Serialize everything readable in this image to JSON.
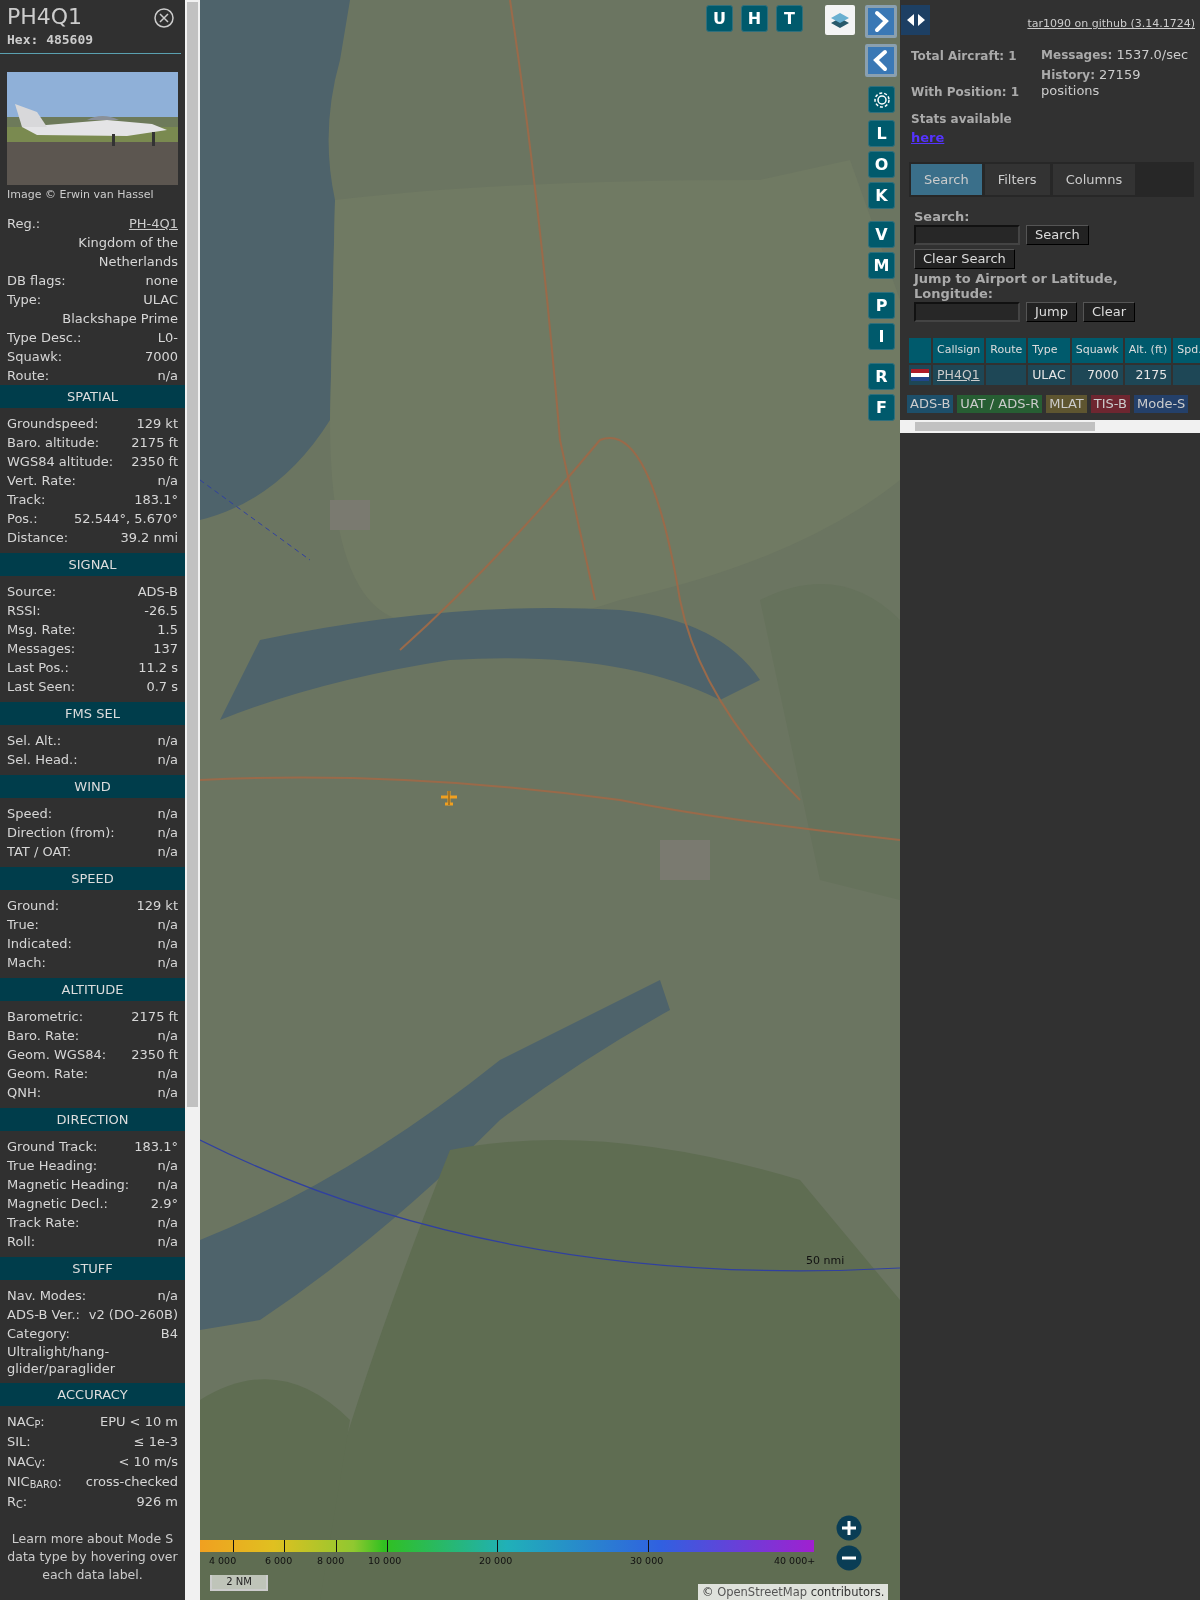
{
  "sidebar": {
    "title": "PH4Q1",
    "hex": "Hex: 485609",
    "image_credit": "Image © Erwin van Hassel",
    "info_rows": [
      {
        "kind": "link",
        "label": "Reg.:",
        "value": "PH-4Q1"
      },
      {
        "kind": "note",
        "value": "Kingdom of the Netherlands"
      },
      {
        "kind": "pair",
        "label": "DB flags:",
        "value": "none"
      },
      {
        "kind": "pair",
        "label": "Type:",
        "value": "ULAC"
      },
      {
        "kind": "note",
        "value": "Blackshape Prime"
      },
      {
        "kind": "pair",
        "label": "Type Desc.:",
        "value": "L0-"
      },
      {
        "kind": "pair",
        "label": "Squawk:",
        "value": "7000"
      },
      {
        "kind": "pair",
        "label": "Route:",
        "value": "n/a"
      }
    ],
    "sections": [
      {
        "heading": "SPATIAL",
        "rows": [
          {
            "kind": "pair",
            "label": "Groundspeed:",
            "value": "129 kt"
          },
          {
            "kind": "pair",
            "label": "Baro. altitude:",
            "value": "2175 ft"
          },
          {
            "kind": "pair",
            "label": "WGS84 altitude:",
            "value": "2350 ft"
          },
          {
            "kind": "pair",
            "label": "Vert. Rate:",
            "value": "n/a"
          },
          {
            "kind": "pair",
            "label": "Track:",
            "value": "183.1°"
          },
          {
            "kind": "pair",
            "label": "Pos.:",
            "value": "52.544°, 5.670°"
          },
          {
            "kind": "pair",
            "label": "Distance:",
            "value": "39.2 nmi"
          }
        ]
      },
      {
        "heading": "SIGNAL",
        "rows": [
          {
            "kind": "pair",
            "label": "Source:",
            "value": "ADS-B"
          },
          {
            "kind": "pair",
            "label": "RSSI:",
            "value": "-26.5"
          },
          {
            "kind": "pair",
            "label": "Msg. Rate:",
            "value": "1.5"
          },
          {
            "kind": "pair",
            "label": "Messages:",
            "value": "137"
          },
          {
            "kind": "pair",
            "label": "Last Pos.:",
            "value": "11.2 s"
          },
          {
            "kind": "pair",
            "label": "Last Seen:",
            "value": "0.7 s"
          }
        ]
      },
      {
        "heading": "FMS SEL",
        "rows": [
          {
            "kind": "pair",
            "label": "Sel. Alt.:",
            "value": "n/a"
          },
          {
            "kind": "pair",
            "label": "Sel. Head.:",
            "value": "n/a"
          }
        ]
      },
      {
        "heading": "WIND",
        "rows": [
          {
            "kind": "pair",
            "label": "Speed:",
            "value": "n/a"
          },
          {
            "kind": "pair",
            "label": "Direction (from):",
            "value": "n/a"
          },
          {
            "kind": "pair",
            "label": "TAT / OAT:",
            "value": "n/a"
          }
        ]
      },
      {
        "heading": "SPEED",
        "rows": [
          {
            "kind": "pair",
            "label": "Ground:",
            "value": "129 kt"
          },
          {
            "kind": "pair",
            "label": "True:",
            "value": "n/a"
          },
          {
            "kind": "pair",
            "label": "Indicated:",
            "value": "n/a"
          },
          {
            "kind": "pair",
            "label": "Mach:",
            "value": "n/a"
          }
        ]
      },
      {
        "heading": "ALTITUDE",
        "rows": [
          {
            "kind": "pair",
            "label": "Barometric:",
            "value": "2175 ft"
          },
          {
            "kind": "pair",
            "label": "Baro. Rate:",
            "value": "n/a"
          },
          {
            "kind": "pair",
            "label": "Geom. WGS84:",
            "value": "2350 ft"
          },
          {
            "kind": "pair",
            "label": "Geom. Rate:",
            "value": "n/a"
          },
          {
            "kind": "pair",
            "label": "QNH:",
            "value": "n/a"
          }
        ]
      },
      {
        "heading": "DIRECTION",
        "rows": [
          {
            "kind": "pair",
            "label": "Ground Track:",
            "value": "183.1°"
          },
          {
            "kind": "pair",
            "label": "True Heading:",
            "value": "n/a"
          },
          {
            "kind": "pair",
            "label": "Magnetic Heading:",
            "value": "n/a"
          },
          {
            "kind": "pair",
            "label": "Magnetic Decl.:",
            "value": "2.9°"
          },
          {
            "kind": "pair",
            "label": "Track Rate:",
            "value": "n/a"
          },
          {
            "kind": "pair",
            "label": "Roll:",
            "value": "n/a"
          }
        ]
      },
      {
        "heading": "STUFF",
        "rows": [
          {
            "kind": "pair",
            "label": "Nav. Modes:",
            "value": "n/a"
          },
          {
            "kind": "pair",
            "label": "ADS-B Ver.:",
            "value": "v2 (DO-260B)"
          },
          {
            "kind": "pair",
            "label": "Category:",
            "value": "B4"
          },
          {
            "kind": "wide",
            "value": "Ultralight/hang-glider/paraglider"
          }
        ]
      },
      {
        "heading": "ACCURACY",
        "rows": [
          {
            "kind": "pair",
            "label": "NAC$_{P}$:",
            "value": "EPU < 10 m"
          },
          {
            "kind": "pair",
            "label": "SIL:",
            "value": "≤ 1e-3"
          },
          {
            "kind": "pair",
            "label": "NAC$_{V}$:",
            "value": "< 10 m/s"
          },
          {
            "kind": "pair",
            "label": "NIC$_{BARO}$:",
            "value": "cross-checked"
          },
          {
            "kind": "pair",
            "label": "R$_{C}$:",
            "value": "926 m"
          }
        ]
      }
    ],
    "footer": "Learn more about Mode S data type by hovering over each data label."
  },
  "map": {
    "top_buttons": [
      "U",
      "H",
      "T"
    ],
    "side_buttons": [
      "L",
      "O",
      "K",
      "V",
      "M",
      "P",
      "I",
      "R",
      "F"
    ],
    "range_label": "50 nmi",
    "legend": [
      "4 000",
      "6 000",
      "8 000",
      "10 000",
      "20 000",
      "30 000",
      "40 000+"
    ],
    "scale": "2 NM",
    "attribution": {
      "prefix": "©",
      "link": "OpenStreetMap",
      "suffix": "contributors."
    }
  },
  "panel": {
    "version_link": "tar1090 on github (3.14.1724)",
    "stats_left": [
      {
        "label": "Total Aircraft:",
        "value": "1"
      },
      {
        "label": "With Position:",
        "value": "1"
      }
    ],
    "stats_right": [
      {
        "label": "Messages:",
        "value": "1537.0/sec"
      },
      {
        "label": "History:",
        "value": "27159 positions"
      }
    ],
    "stats_note": "Stats available",
    "stats_link": "here",
    "tabs": [
      {
        "label": "Search",
        "selected": true
      },
      {
        "label": "Filters",
        "selected": false
      },
      {
        "label": "Columns",
        "selected": false
      }
    ],
    "search": {
      "label": "Search:",
      "button": "Search",
      "clear_button": "Clear Search"
    },
    "jump": {
      "label": "Jump to Airport or Latitude, Longitude:",
      "button": "Jump",
      "clear_button": "Clear"
    },
    "table": {
      "columns": [
        "Callsign",
        "Route",
        "Type",
        "Squawk",
        "Alt. (ft)",
        "Spd."
      ],
      "rows": [
        {
          "callsign": "PH4Q1",
          "type": "ULAC",
          "squawk": "7000",
          "altitude": "2175"
        }
      ]
    },
    "sources": [
      {
        "label": "ADS-B",
        "color": "#1d4f6a"
      },
      {
        "label": "UAT / ADS-R",
        "color": "#275e33"
      },
      {
        "label": "MLAT",
        "color": "#5e5530"
      },
      {
        "label": "TIS-B",
        "color": "#6e2630"
      },
      {
        "label": "Mode-S",
        "color": "#24406a"
      }
    ]
  }
}
